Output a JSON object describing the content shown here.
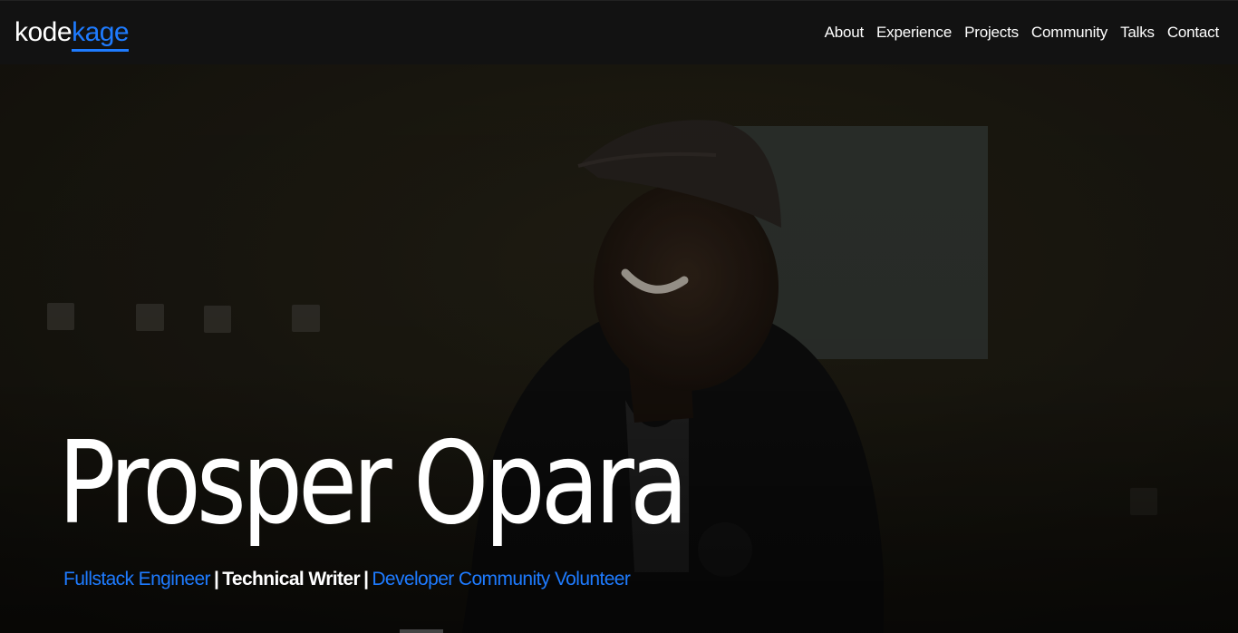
{
  "brand": {
    "part1": "kode",
    "part2": "kage",
    "accent": "#1e7bff"
  },
  "nav": {
    "items": [
      {
        "label": "About"
      },
      {
        "label": "Experience"
      },
      {
        "label": "Projects"
      },
      {
        "label": "Community"
      },
      {
        "label": "Talks"
      },
      {
        "label": "Contact"
      }
    ]
  },
  "hero": {
    "name": "Prosper Opara",
    "roles": [
      {
        "label": "Fullstack Engineer",
        "color": "blue"
      },
      {
        "label": "Technical Writer",
        "color": "white"
      },
      {
        "label": "Developer Community Volunteer",
        "color": "blue"
      }
    ],
    "separator": "|",
    "background_image": "smiling-man-in-cap-photo"
  }
}
